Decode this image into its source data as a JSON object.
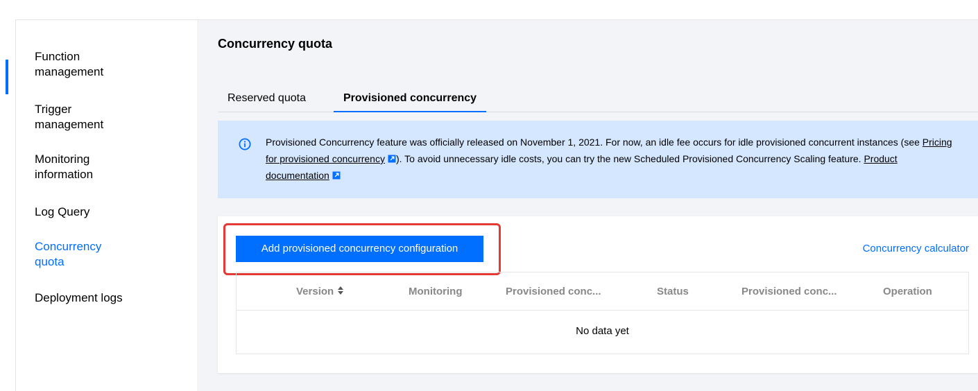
{
  "sidebar": {
    "items": [
      {
        "label": "Function management",
        "active": false
      },
      {
        "label": "Trigger management",
        "active": false
      },
      {
        "label": "Monitoring information",
        "active": false
      },
      {
        "label": "Log Query",
        "active": false
      },
      {
        "label": "Concurrency quota",
        "active": true
      },
      {
        "label": "Deployment logs",
        "active": false
      }
    ]
  },
  "page": {
    "title": "Concurrency quota"
  },
  "tabs": [
    {
      "label": "Reserved quota",
      "active": false
    },
    {
      "label": "Provisioned concurrency",
      "active": true
    }
  ],
  "notice": {
    "icon": "info-icon",
    "text_1": "Provisioned Concurrency feature was officially released on November 1, 2021. For now, an idle fee occurs for idle provisioned concurrent instances (see ",
    "link_1": "Pricing for provisioned concurrency",
    "text_2": "). To avoid unnecessary idle costs, you can try the new Scheduled Provisioned Concurrency Scaling feature. ",
    "link_2": "Product documentation"
  },
  "card": {
    "add_button": "Add provisioned concurrency configuration",
    "calculator_link": "Concurrency calculator"
  },
  "table": {
    "columns": [
      "Version",
      "Monitoring",
      "Provisioned conc...",
      "Status",
      "Provisioned conc...",
      "Operation"
    ],
    "empty_text": "No data yet"
  },
  "colors": {
    "accent": "#006eff",
    "notice_bg": "#d5e7ff",
    "highlight": "#e53935"
  }
}
